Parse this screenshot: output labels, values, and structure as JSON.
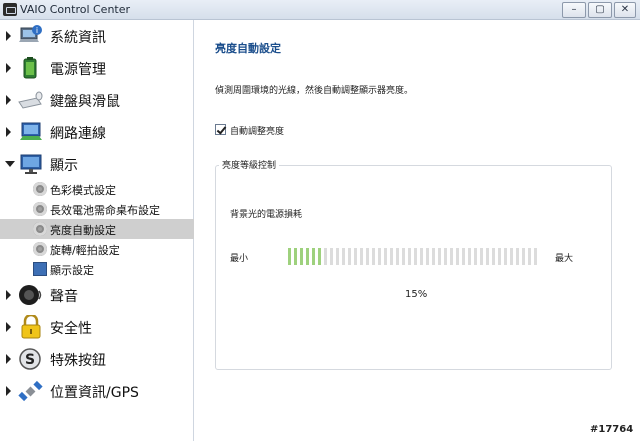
{
  "window": {
    "title": "VAIO Control Center"
  },
  "sidebar": {
    "items": [
      {
        "label": "系統資訊",
        "icon": "computer-info-icon"
      },
      {
        "label": "電源管理",
        "icon": "battery-icon"
      },
      {
        "label": "鍵盤與滑鼠",
        "icon": "keyboard-icon"
      },
      {
        "label": "網路連線",
        "icon": "network-icon"
      },
      {
        "label": "顯示",
        "icon": "display-icon",
        "expanded": true
      },
      {
        "label": "聲音",
        "icon": "speaker-icon"
      },
      {
        "label": "安全性",
        "icon": "lock-icon"
      },
      {
        "label": "特殊按鈕",
        "icon": "s-button-icon"
      },
      {
        "label": "位置資訊/GPS",
        "icon": "satellite-icon"
      }
    ],
    "display_children": [
      {
        "label": "色彩模式設定"
      },
      {
        "label": "長效電池需命桌布設定"
      },
      {
        "label": "亮度自動設定",
        "selected": true
      },
      {
        "label": "旋轉/輕拍設定"
      },
      {
        "label": "顯示設定"
      }
    ]
  },
  "main": {
    "title": "亮度自動設定",
    "description": "偵測周圍環境的光線，然後自動調整顯示器亮度。",
    "auto_brightness": {
      "label": "自動調整亮度",
      "checked": true
    },
    "group": {
      "title": "亮度等級控制",
      "subtitle": "背景光的電源損耗",
      "min_label": "最小",
      "max_label": "最大",
      "level_percent_text": "15%",
      "level_fraction": 0.15
    }
  },
  "colors": {
    "accent_title": "#1b4e8c",
    "meter_on": "#9ed17d",
    "meter_off": "#dcdcdc",
    "selected_row": "#cfcfcf"
  },
  "watermark": "#17764"
}
